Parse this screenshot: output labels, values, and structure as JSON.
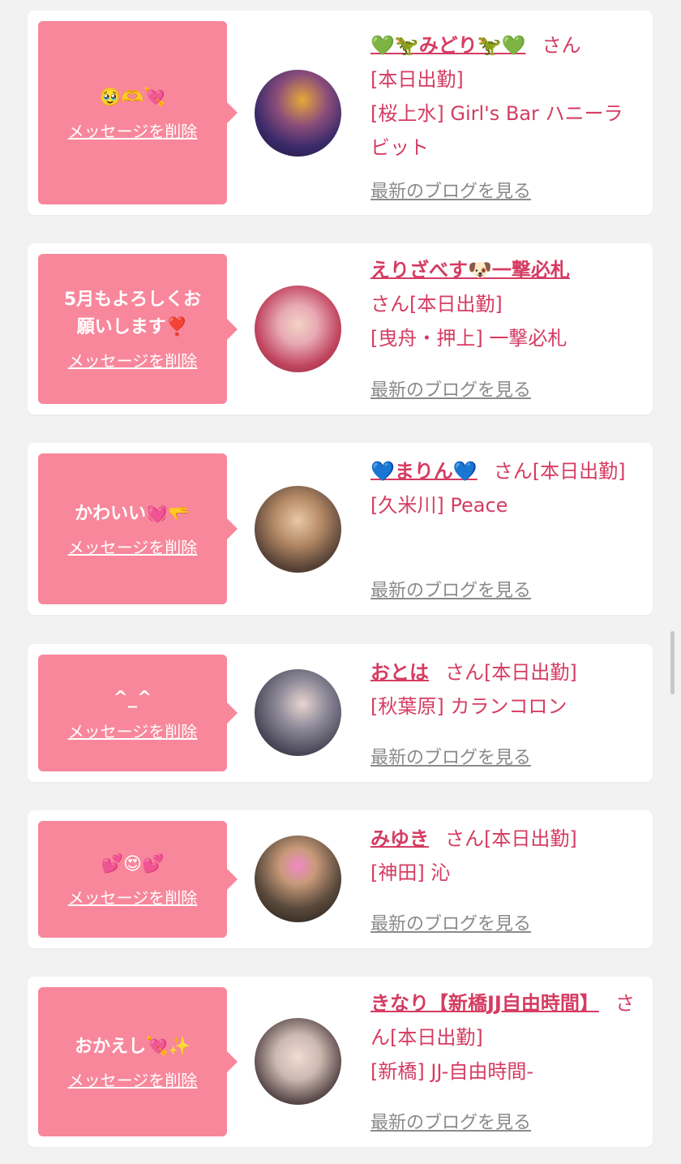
{
  "common": {
    "delete_label": "メッセージを削除",
    "blog_label": "最新のブログを見る",
    "san": "さん"
  },
  "colors": {
    "bubble": "#f8879b",
    "accent_text": "#d53c62",
    "link_gray": "#8a8a8a",
    "background": "#f2f2f2"
  },
  "items": [
    {
      "message": "🥹🫶💘",
      "name": "💚🦖みどり🦖💚",
      "status": "[本日出勤]",
      "shop": "[桜上水] Girl's Bar ハニーラビット"
    },
    {
      "message": "5月もよろしくお\n願いします❣️",
      "name": "えりざべす🐶一撃必札",
      "status": "[本日出勤]",
      "shop": "[曳舟・押上] 一撃必札"
    },
    {
      "message": "かわいい💓🫳",
      "name": "💙まりん💙",
      "status": "[本日出勤]",
      "shop": "[久米川] Peace"
    },
    {
      "message": "^_^",
      "name": "おとは",
      "status": "[本日出勤]",
      "shop": "[秋葉原] カランコロン"
    },
    {
      "message": "💕😍💕",
      "name": "みゆき",
      "status": "[本日出勤]",
      "shop": "[神田] 沁"
    },
    {
      "message": "おかえし💘✨",
      "name": "きなり【新橋JJ自由時間】",
      "status": "[本日出勤]",
      "shop": "[新橋] JJ-自由時間-"
    }
  ]
}
